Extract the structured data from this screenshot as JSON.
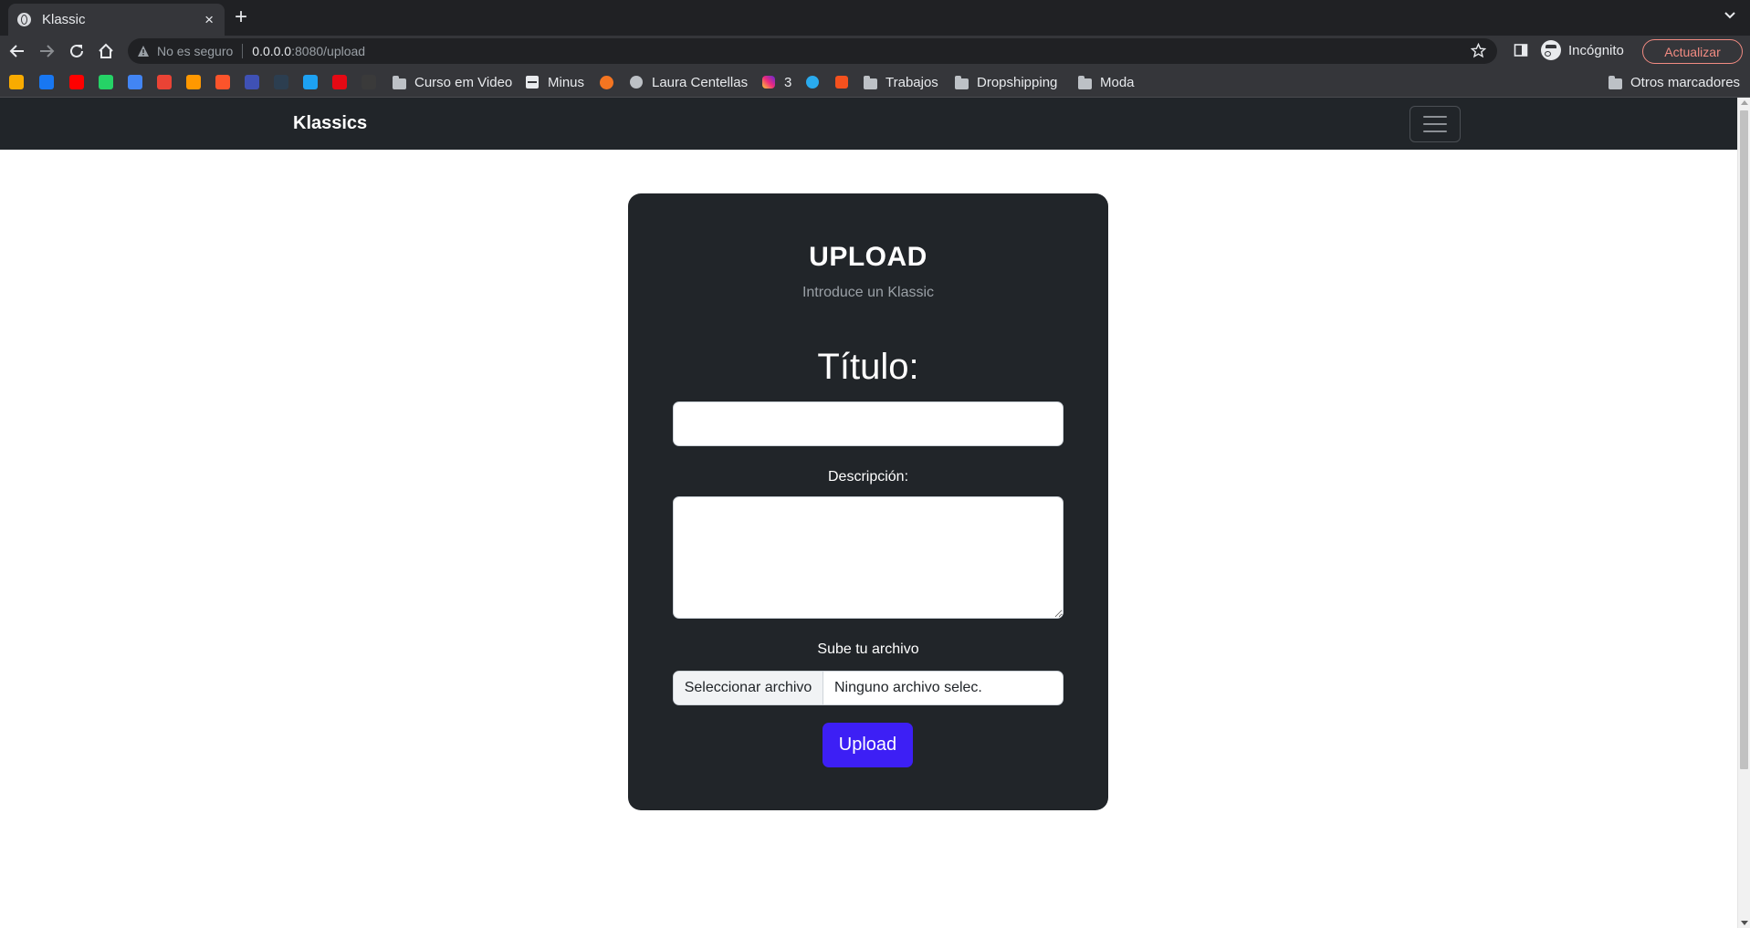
{
  "browser": {
    "tab_title": "Klassic",
    "tab_close": "×",
    "new_tab": "+",
    "security_label": "No es seguro",
    "url_host": "0.0.0.0",
    "url_path": ":8080/upload",
    "incognito_label": "Incógnito",
    "update_button": "Actualizar"
  },
  "bookmarks": {
    "icons": [
      {
        "name": "bookmark-icon-1",
        "color": "#f9ab00"
      },
      {
        "name": "facebook-icon",
        "color": "#1877f2"
      },
      {
        "name": "youtube-icon",
        "color": "#ff0000"
      },
      {
        "name": "whatsapp-icon",
        "color": "#25d366"
      },
      {
        "name": "translate-icon",
        "color": "#4285f4"
      },
      {
        "name": "gmail-icon",
        "color": "#ea4335"
      },
      {
        "name": "bookmark-icon-7",
        "color": "#ff9800"
      },
      {
        "name": "brave-icon",
        "color": "#fb542b"
      },
      {
        "name": "bookmark-icon-9",
        "color": "#3f51b5"
      },
      {
        "name": "bookmark-icon-10",
        "color": "#2c3e50"
      },
      {
        "name": "twitter-icon",
        "color": "#1da1f2"
      },
      {
        "name": "netflix-icon",
        "color": "#e50914"
      },
      {
        "name": "af-icon",
        "color": "#3a3a3a"
      }
    ],
    "items": [
      {
        "label": "Curso em Video",
        "icon": "folder-icon"
      },
      {
        "label": "Minus",
        "icon": "minus-icon"
      },
      {
        "label": "Laura Centellas",
        "icon": "globe-icon"
      },
      {
        "label": "3",
        "icon": "instagram-icon"
      },
      {
        "label": "Trabajos",
        "icon": "folder-icon"
      },
      {
        "label": "Dropshipping",
        "icon": "folder-icon"
      },
      {
        "label": "Moda",
        "icon": "folder-icon"
      }
    ],
    "other": "Otros marcadores"
  },
  "navbar": {
    "brand": "Klassics"
  },
  "form": {
    "heading": "UPLOAD",
    "subheading": "Introduce un Klassic",
    "title_label": "Título:",
    "title_value": "",
    "description_label": "Descripción:",
    "description_value": "",
    "file_label": "Sube tu archivo",
    "file_button": "Seleccionar archivo",
    "file_status": "Ninguno archivo selec.",
    "submit": "Upload"
  },
  "colors": {
    "navbar_bg": "#212529",
    "card_bg": "#212529",
    "accent": "#3d1ff5"
  }
}
